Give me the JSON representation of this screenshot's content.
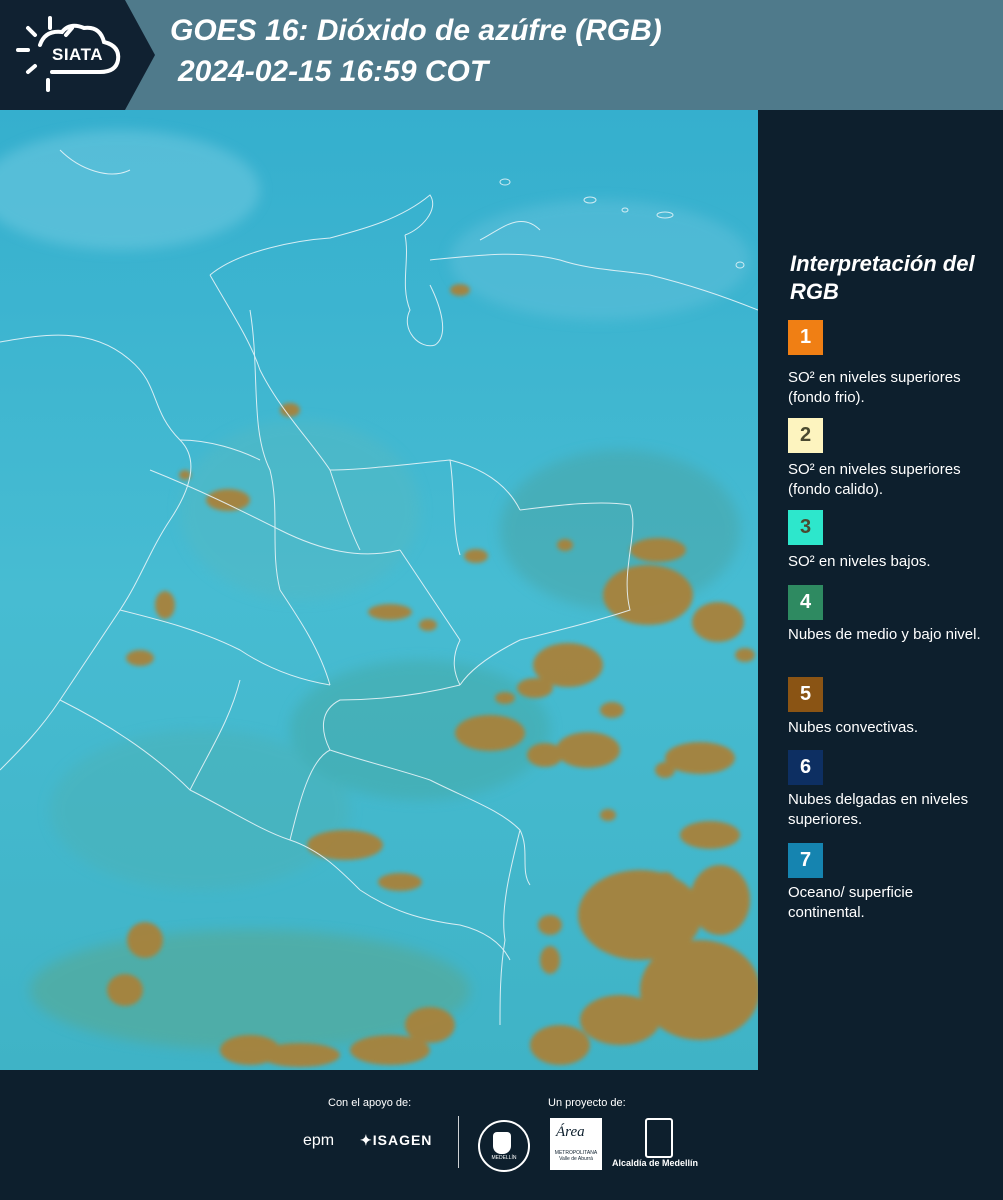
{
  "header": {
    "logo_text": "SIATA",
    "title_line1": "GOES 16: Dióxido de azúfre (RGB)",
    "title_line2": "2024-02-15 16:59 COT",
    "colors": {
      "bar": "#4f7a8b",
      "logo_bg": "#102131"
    }
  },
  "legend": {
    "title": "Interpretación del RGB",
    "items": [
      {
        "number": "1",
        "label": "SO² en niveles superiores (fondo frio).",
        "color": "#f07f14"
      },
      {
        "number": "2",
        "label": "SO² en niveles superiores (fondo calido).",
        "color": "#fdf4bf"
      },
      {
        "number": "3",
        "label": "SO² en niveles bajos.",
        "color": "#2de7cc"
      },
      {
        "number": "4",
        "label": "Nubes de medio y bajo nivel.",
        "color": "#2e8a61"
      },
      {
        "number": "5",
        "label": "Nubes convectivas.",
        "color": "#8a5414"
      },
      {
        "number": "6",
        "label": "Nubes delgadas en niveles superiores.",
        "color": "#0d2f62"
      },
      {
        "number": "7",
        "label": "Oceano/ superficie continental.",
        "color": "#1584b0"
      }
    ]
  },
  "footer": {
    "support_label": "Con el apoyo de:",
    "project_label": "Un proyecto de:",
    "sponsor1": "epm",
    "sponsor2": "ISAGEN",
    "partner1_sub": "MEDELLÍN",
    "partner2": "Área",
    "partner2_sub": "METROPOLITANA Valle de Aburrá",
    "partner3": "Alcaldía de Medellín"
  },
  "map": {
    "background_color": "#3fb6cf",
    "convective_color": "#a8823a",
    "border_color": "#e8f4f8"
  }
}
